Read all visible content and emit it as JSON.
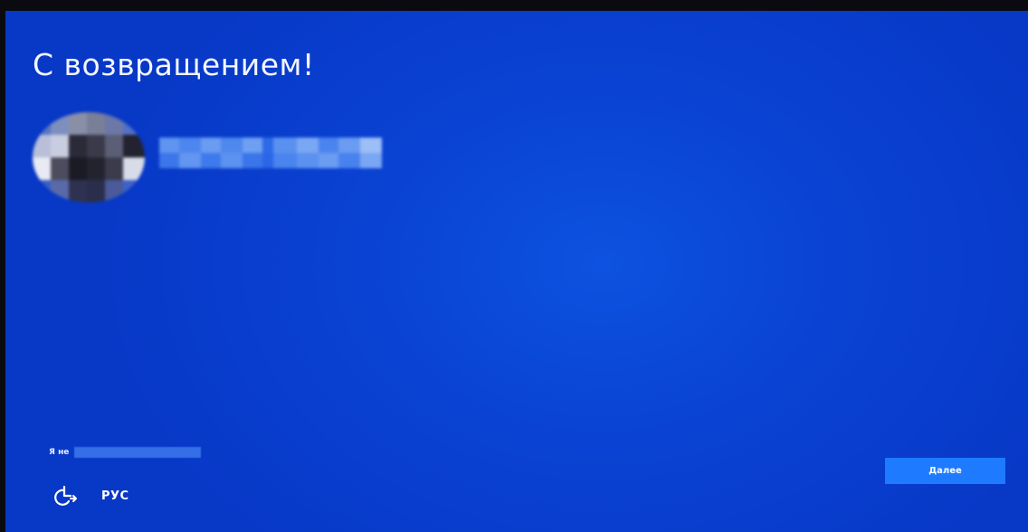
{
  "screen": {
    "title": "С возвращением!",
    "background_color": "#0a43d4",
    "accent_color": "#1e7bff"
  },
  "account": {
    "avatar_icon": "user-avatar-pixelated",
    "username_redacted": true
  },
  "footer": {
    "not_me_prefix": "Я не",
    "accessibility_icon": "ease-of-access-icon",
    "language_label": "РУС",
    "next_button_label": "Далее"
  }
}
